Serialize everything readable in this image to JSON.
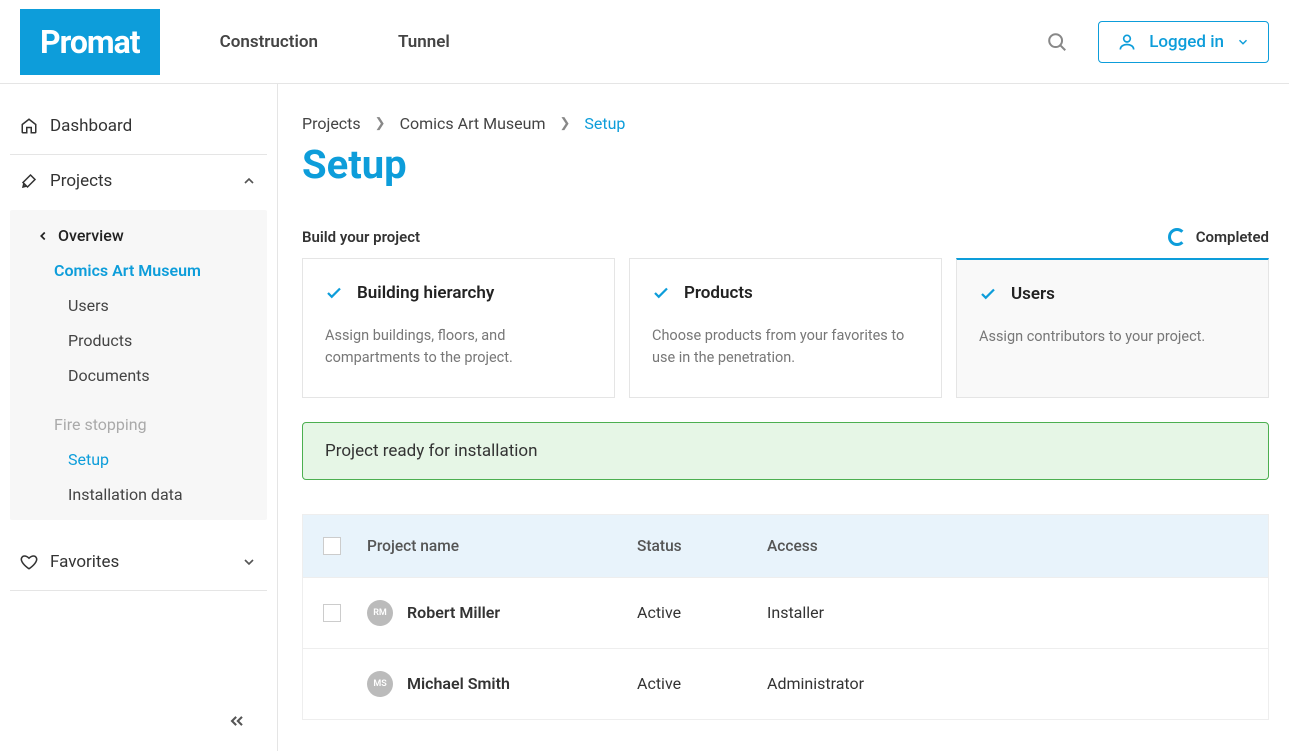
{
  "header": {
    "logo": "Promat",
    "nav": {
      "construction": "Construction",
      "tunnel": "Tunnel"
    },
    "logged_in": "Logged in"
  },
  "sidebar": {
    "dashboard": "Dashboard",
    "projects": "Projects",
    "overview": "Overview",
    "project_name": "Comics Art Museum",
    "users": "Users",
    "products": "Products",
    "documents": "Documents",
    "fire_stopping": "Fire stopping",
    "setup": "Setup",
    "installation_data": "Installation data",
    "favorites": "Favorites"
  },
  "breadcrumb": {
    "projects": "Projects",
    "project": "Comics Art Museum",
    "current": "Setup"
  },
  "page_title": "Setup",
  "build_label": "Build your project",
  "completed_label": "Completed",
  "cards": {
    "building": {
      "title": "Building hierarchy",
      "desc": "Assign buildings, floors, and compartments to the project."
    },
    "products": {
      "title": "Products",
      "desc": "Choose products from your favorites to use in the penetration."
    },
    "users": {
      "title": "Users",
      "desc": "Assign contributors to your project."
    }
  },
  "banner": "Project ready for installation",
  "table": {
    "headers": {
      "name": "Project name",
      "status": "Status",
      "access": "Access"
    },
    "rows": [
      {
        "initials": "RM",
        "name": "Robert Miller",
        "status": "Active",
        "access": "Installer",
        "checkbox": true
      },
      {
        "initials": "MS",
        "name": "Michael Smith",
        "status": "Active",
        "access": "Administrator",
        "checkbox": false
      }
    ]
  }
}
